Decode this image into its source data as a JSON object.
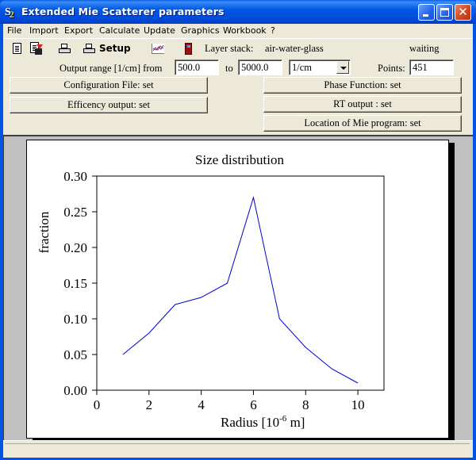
{
  "window": {
    "title": "Extended Mie Scatterer parameters",
    "app_icon": "S2",
    "controls": {
      "minimize": "minimize",
      "maximize": "maximize",
      "close": "close"
    }
  },
  "menu": {
    "items": [
      "File",
      "Import",
      "Export",
      "Calculate",
      "Update",
      "Graphics",
      "Workbook",
      "?"
    ]
  },
  "toolbar": {
    "icons": [
      "new-document-icon",
      "save-icon",
      "print-icon",
      "print-setup-icon",
      "graph-icon",
      "exit-door-icon"
    ],
    "setup_label": "Setup",
    "layer_stack_label": "Layer stack:",
    "layer_stack_value": "air-water-glass",
    "status": "waiting"
  },
  "range": {
    "label": "Output range [1/cm] from",
    "from_value": "500.0",
    "to_label": "to",
    "to_value": "5000.0",
    "unit_selected": "1/cm",
    "points_label": "Points:",
    "points_value": "451"
  },
  "buttons": {
    "config_file": "Configuration File: set",
    "efficiency_output": "Efficency output: set",
    "phase_function": "Phase Function: set",
    "rt_output": "RT output : set",
    "mie_location": "Location of Mie program: set"
  },
  "chart_data": {
    "type": "line",
    "title": "Size distribution",
    "xlabel": "Radius [10^-6 m]",
    "xlabel_main": "Radius [10",
    "xlabel_exp": "-6",
    "xlabel_tail": " m]",
    "ylabel": "fraction",
    "xlim": [
      0,
      11
    ],
    "ylim": [
      0,
      0.3
    ],
    "x_ticks": [
      0,
      2,
      4,
      6,
      8,
      10
    ],
    "x_tick_labels": [
      "0",
      "2",
      "4",
      "6",
      "8",
      "10"
    ],
    "y_ticks": [
      0,
      0.05,
      0.1,
      0.15,
      0.2,
      0.25,
      0.3
    ],
    "y_tick_labels": [
      "0.00",
      "0.05",
      "0.10",
      "0.15",
      "0.20",
      "0.25",
      "0.30"
    ],
    "grid": false,
    "series": [
      {
        "name": "size distribution",
        "color": "#0000cc",
        "x": [
          1,
          2,
          3,
          4,
          5,
          6,
          7,
          8,
          9,
          10
        ],
        "values": [
          0.05,
          0.08,
          0.12,
          0.13,
          0.15,
          0.27,
          0.1,
          0.06,
          0.03,
          0.01
        ]
      }
    ]
  }
}
